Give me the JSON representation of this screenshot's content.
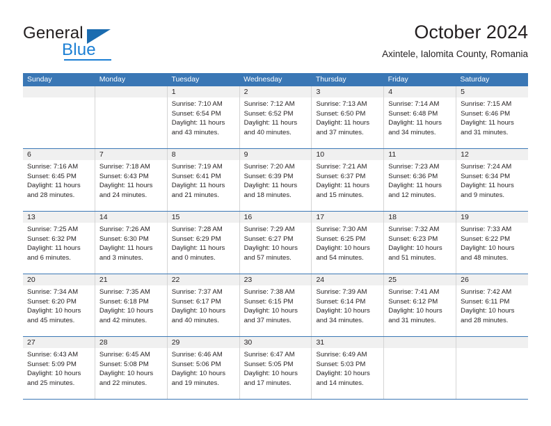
{
  "brand": {
    "name_part1": "General",
    "name_part2": "Blue",
    "triangle_color": "#1b6cb0",
    "blue_color": "#1b7fd4"
  },
  "header": {
    "title": "October 2024",
    "subtitle": "Axintele, Ialomita County, Romania"
  },
  "theme": {
    "header_bg": "#3a77b5",
    "daynum_bg": "#f0f0f0",
    "grid_line": "#d4d4d4",
    "text": "#231f20"
  },
  "weekdays": [
    "Sunday",
    "Monday",
    "Tuesday",
    "Wednesday",
    "Thursday",
    "Friday",
    "Saturday"
  ],
  "weeks": [
    [
      {
        "day": "",
        "sunrise": "",
        "sunset": "",
        "daylight_line1": "",
        "daylight_line2": ""
      },
      {
        "day": "",
        "sunrise": "",
        "sunset": "",
        "daylight_line1": "",
        "daylight_line2": ""
      },
      {
        "day": "1",
        "sunrise": "Sunrise: 7:10 AM",
        "sunset": "Sunset: 6:54 PM",
        "daylight_line1": "Daylight: 11 hours",
        "daylight_line2": "and 43 minutes."
      },
      {
        "day": "2",
        "sunrise": "Sunrise: 7:12 AM",
        "sunset": "Sunset: 6:52 PM",
        "daylight_line1": "Daylight: 11 hours",
        "daylight_line2": "and 40 minutes."
      },
      {
        "day": "3",
        "sunrise": "Sunrise: 7:13 AM",
        "sunset": "Sunset: 6:50 PM",
        "daylight_line1": "Daylight: 11 hours",
        "daylight_line2": "and 37 minutes."
      },
      {
        "day": "4",
        "sunrise": "Sunrise: 7:14 AM",
        "sunset": "Sunset: 6:48 PM",
        "daylight_line1": "Daylight: 11 hours",
        "daylight_line2": "and 34 minutes."
      },
      {
        "day": "5",
        "sunrise": "Sunrise: 7:15 AM",
        "sunset": "Sunset: 6:46 PM",
        "daylight_line1": "Daylight: 11 hours",
        "daylight_line2": "and 31 minutes."
      }
    ],
    [
      {
        "day": "6",
        "sunrise": "Sunrise: 7:16 AM",
        "sunset": "Sunset: 6:45 PM",
        "daylight_line1": "Daylight: 11 hours",
        "daylight_line2": "and 28 minutes."
      },
      {
        "day": "7",
        "sunrise": "Sunrise: 7:18 AM",
        "sunset": "Sunset: 6:43 PM",
        "daylight_line1": "Daylight: 11 hours",
        "daylight_line2": "and 24 minutes."
      },
      {
        "day": "8",
        "sunrise": "Sunrise: 7:19 AM",
        "sunset": "Sunset: 6:41 PM",
        "daylight_line1": "Daylight: 11 hours",
        "daylight_line2": "and 21 minutes."
      },
      {
        "day": "9",
        "sunrise": "Sunrise: 7:20 AM",
        "sunset": "Sunset: 6:39 PM",
        "daylight_line1": "Daylight: 11 hours",
        "daylight_line2": "and 18 minutes."
      },
      {
        "day": "10",
        "sunrise": "Sunrise: 7:21 AM",
        "sunset": "Sunset: 6:37 PM",
        "daylight_line1": "Daylight: 11 hours",
        "daylight_line2": "and 15 minutes."
      },
      {
        "day": "11",
        "sunrise": "Sunrise: 7:23 AM",
        "sunset": "Sunset: 6:36 PM",
        "daylight_line1": "Daylight: 11 hours",
        "daylight_line2": "and 12 minutes."
      },
      {
        "day": "12",
        "sunrise": "Sunrise: 7:24 AM",
        "sunset": "Sunset: 6:34 PM",
        "daylight_line1": "Daylight: 11 hours",
        "daylight_line2": "and 9 minutes."
      }
    ],
    [
      {
        "day": "13",
        "sunrise": "Sunrise: 7:25 AM",
        "sunset": "Sunset: 6:32 PM",
        "daylight_line1": "Daylight: 11 hours",
        "daylight_line2": "and 6 minutes."
      },
      {
        "day": "14",
        "sunrise": "Sunrise: 7:26 AM",
        "sunset": "Sunset: 6:30 PM",
        "daylight_line1": "Daylight: 11 hours",
        "daylight_line2": "and 3 minutes."
      },
      {
        "day": "15",
        "sunrise": "Sunrise: 7:28 AM",
        "sunset": "Sunset: 6:29 PM",
        "daylight_line1": "Daylight: 11 hours",
        "daylight_line2": "and 0 minutes."
      },
      {
        "day": "16",
        "sunrise": "Sunrise: 7:29 AM",
        "sunset": "Sunset: 6:27 PM",
        "daylight_line1": "Daylight: 10 hours",
        "daylight_line2": "and 57 minutes."
      },
      {
        "day": "17",
        "sunrise": "Sunrise: 7:30 AM",
        "sunset": "Sunset: 6:25 PM",
        "daylight_line1": "Daylight: 10 hours",
        "daylight_line2": "and 54 minutes."
      },
      {
        "day": "18",
        "sunrise": "Sunrise: 7:32 AM",
        "sunset": "Sunset: 6:23 PM",
        "daylight_line1": "Daylight: 10 hours",
        "daylight_line2": "and 51 minutes."
      },
      {
        "day": "19",
        "sunrise": "Sunrise: 7:33 AM",
        "sunset": "Sunset: 6:22 PM",
        "daylight_line1": "Daylight: 10 hours",
        "daylight_line2": "and 48 minutes."
      }
    ],
    [
      {
        "day": "20",
        "sunrise": "Sunrise: 7:34 AM",
        "sunset": "Sunset: 6:20 PM",
        "daylight_line1": "Daylight: 10 hours",
        "daylight_line2": "and 45 minutes."
      },
      {
        "day": "21",
        "sunrise": "Sunrise: 7:35 AM",
        "sunset": "Sunset: 6:18 PM",
        "daylight_line1": "Daylight: 10 hours",
        "daylight_line2": "and 42 minutes."
      },
      {
        "day": "22",
        "sunrise": "Sunrise: 7:37 AM",
        "sunset": "Sunset: 6:17 PM",
        "daylight_line1": "Daylight: 10 hours",
        "daylight_line2": "and 40 minutes."
      },
      {
        "day": "23",
        "sunrise": "Sunrise: 7:38 AM",
        "sunset": "Sunset: 6:15 PM",
        "daylight_line1": "Daylight: 10 hours",
        "daylight_line2": "and 37 minutes."
      },
      {
        "day": "24",
        "sunrise": "Sunrise: 7:39 AM",
        "sunset": "Sunset: 6:14 PM",
        "daylight_line1": "Daylight: 10 hours",
        "daylight_line2": "and 34 minutes."
      },
      {
        "day": "25",
        "sunrise": "Sunrise: 7:41 AM",
        "sunset": "Sunset: 6:12 PM",
        "daylight_line1": "Daylight: 10 hours",
        "daylight_line2": "and 31 minutes."
      },
      {
        "day": "26",
        "sunrise": "Sunrise: 7:42 AM",
        "sunset": "Sunset: 6:11 PM",
        "daylight_line1": "Daylight: 10 hours",
        "daylight_line2": "and 28 minutes."
      }
    ],
    [
      {
        "day": "27",
        "sunrise": "Sunrise: 6:43 AM",
        "sunset": "Sunset: 5:09 PM",
        "daylight_line1": "Daylight: 10 hours",
        "daylight_line2": "and 25 minutes."
      },
      {
        "day": "28",
        "sunrise": "Sunrise: 6:45 AM",
        "sunset": "Sunset: 5:08 PM",
        "daylight_line1": "Daylight: 10 hours",
        "daylight_line2": "and 22 minutes."
      },
      {
        "day": "29",
        "sunrise": "Sunrise: 6:46 AM",
        "sunset": "Sunset: 5:06 PM",
        "daylight_line1": "Daylight: 10 hours",
        "daylight_line2": "and 19 minutes."
      },
      {
        "day": "30",
        "sunrise": "Sunrise: 6:47 AM",
        "sunset": "Sunset: 5:05 PM",
        "daylight_line1": "Daylight: 10 hours",
        "daylight_line2": "and 17 minutes."
      },
      {
        "day": "31",
        "sunrise": "Sunrise: 6:49 AM",
        "sunset": "Sunset: 5:03 PM",
        "daylight_line1": "Daylight: 10 hours",
        "daylight_line2": "and 14 minutes."
      },
      {
        "day": "",
        "sunrise": "",
        "sunset": "",
        "daylight_line1": "",
        "daylight_line2": ""
      },
      {
        "day": "",
        "sunrise": "",
        "sunset": "",
        "daylight_line1": "",
        "daylight_line2": ""
      }
    ]
  ]
}
